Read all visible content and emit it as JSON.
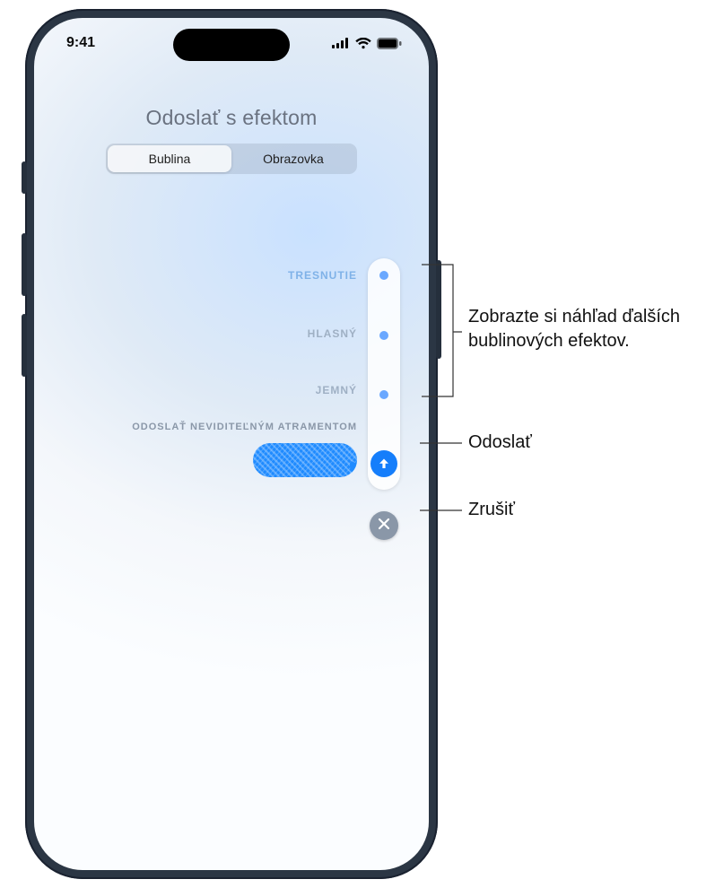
{
  "status": {
    "time": "9:41"
  },
  "screen": {
    "title": "Odoslať s efektom",
    "tabs": {
      "bubble": "Bublina",
      "screen": "Obrazovka"
    }
  },
  "effects": {
    "slam": "TRESNUTIE",
    "loud": "HLASNÝ",
    "gentle": "JEMNÝ",
    "invisible_ink": "ODOSLAŤ NEVIDITEĽNÝM ATRAMENTOM"
  },
  "callouts": {
    "preview": "Zobrazte si náhľad ďalších bublinových efektov.",
    "send": "Odoslať",
    "cancel": "Zrušiť"
  }
}
